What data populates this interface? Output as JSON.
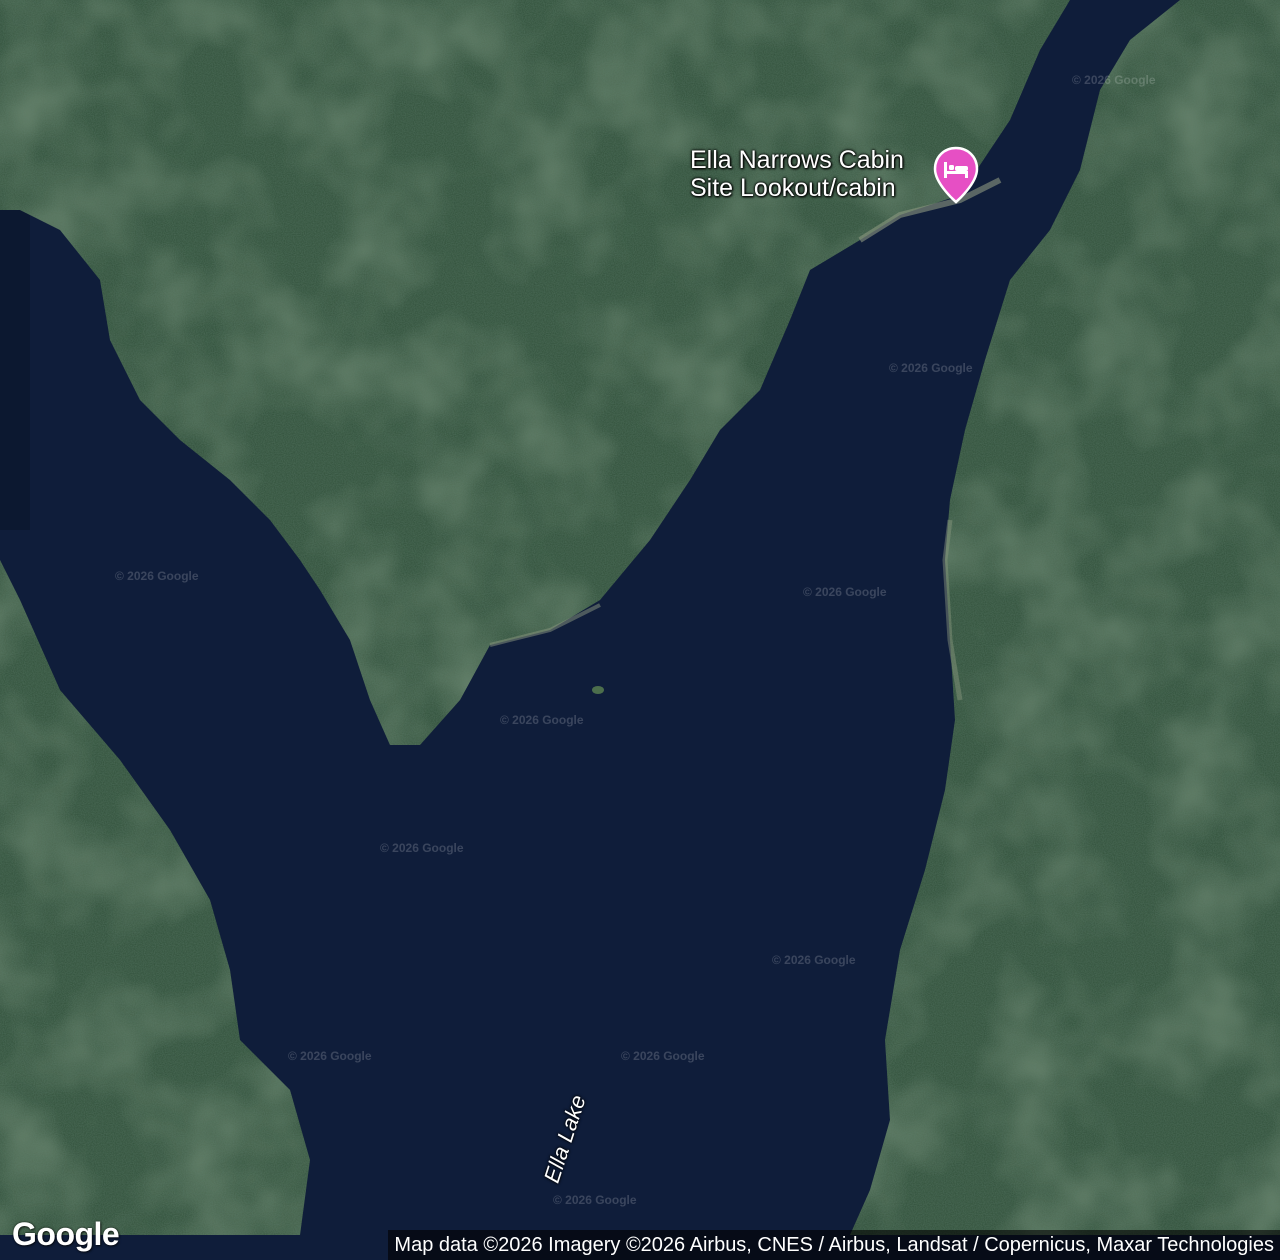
{
  "map": {
    "type": "satellite",
    "colors": {
      "water": "#0f1d3a",
      "forest": "#31503a",
      "forest_light": "#4c6e4c",
      "forest_dark": "#1f3a2c",
      "shore": "#9aa48c",
      "poi_pin": "#e64fc4"
    }
  },
  "poi": {
    "label_line1": "Ella Narrows Cabin",
    "label_line2": "Site Lookout/cabin",
    "icon": "bed-icon"
  },
  "lake": {
    "label": "Ella Lake"
  },
  "watermark": {
    "text": "© 2026 Google"
  },
  "branding": {
    "logo": "Google"
  },
  "attribution": {
    "text": "Map data ©2026 Imagery ©2026 Airbus, CNES / Airbus, Landsat / Copernicus, Maxar Technologies"
  }
}
